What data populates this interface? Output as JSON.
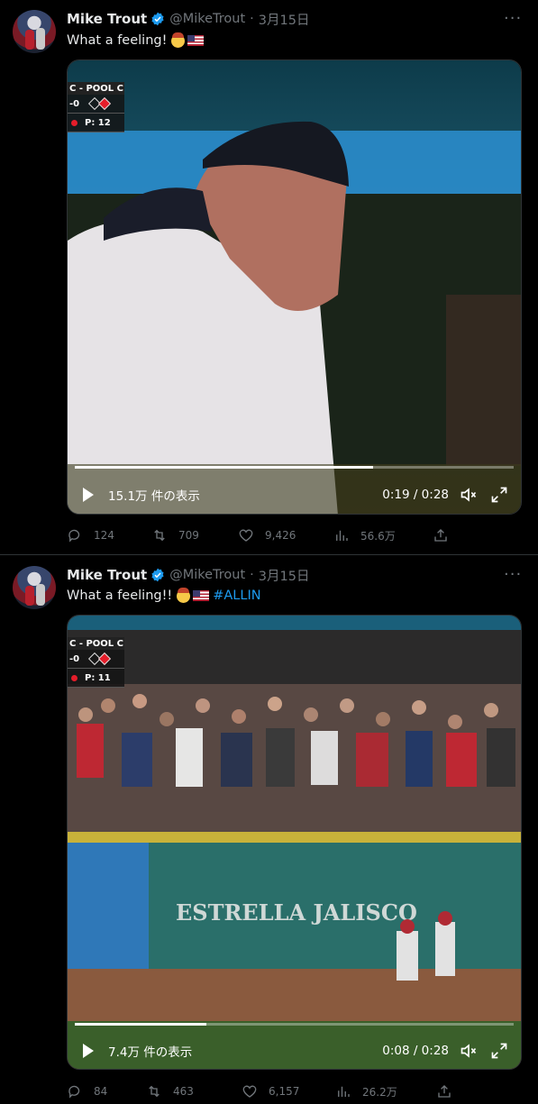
{
  "tweets": [
    {
      "author": {
        "name": "Mike Trout",
        "handle": "@MikeTrout",
        "date": "3月15日"
      },
      "text": "What a feeling!",
      "hashtag": "",
      "video": {
        "scorebug": {
          "pool": "C - POOL C",
          "score": "-0",
          "pitches": "P: 12"
        },
        "views": "15.1万 件の表示",
        "time": "0:19 / 0:28",
        "progress": 0.68
      },
      "actions": {
        "replies": "124",
        "retweets": "709",
        "likes": "9,426",
        "views": "56.6万"
      }
    },
    {
      "author": {
        "name": "Mike Trout",
        "handle": "@MikeTrout",
        "date": "3月15日"
      },
      "text": "What a feeling!!",
      "hashtag": "#ALLIN",
      "video": {
        "scorebug": {
          "pool": "C - POOL C",
          "score": "-0",
          "pitches": "P: 11"
        },
        "banner": "ESTRELLA  JALISCO",
        "views": "7.4万 件の表示",
        "time": "0:08 / 0:28",
        "progress": 0.3
      },
      "actions": {
        "replies": "84",
        "retweets": "463",
        "likes": "6,157",
        "views": "26.2万"
      }
    }
  ],
  "icons": {
    "more": "more-icon",
    "verified": "verified-badge-icon",
    "reply": "reply-icon",
    "retweet": "retweet-icon",
    "like": "heart-icon",
    "views": "analytics-icon",
    "share": "share-icon",
    "mute": "mute-icon",
    "fullscreen": "fullscreen-icon"
  },
  "colors": {
    "background": "#000000",
    "accent": "#1d9bf0",
    "muted": "#71767b"
  }
}
